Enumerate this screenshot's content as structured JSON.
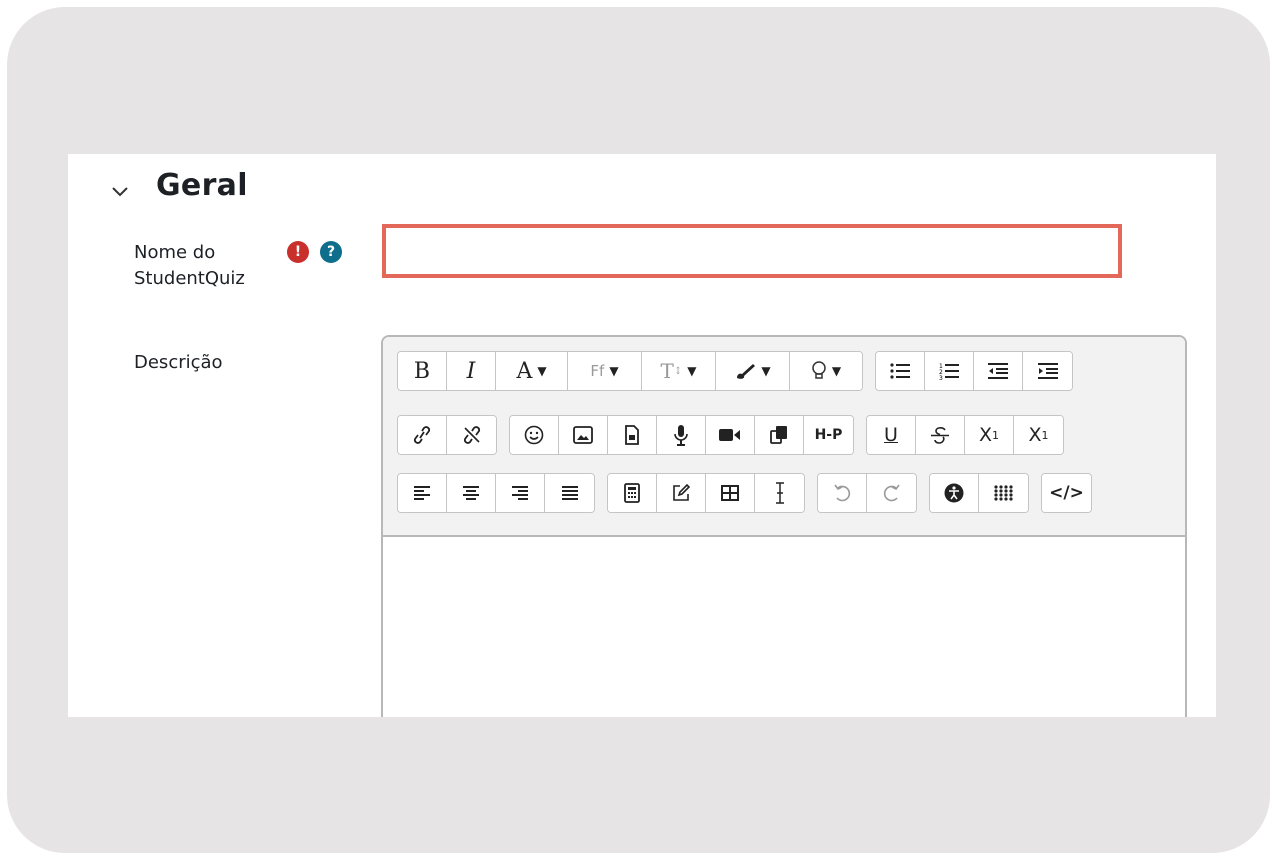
{
  "section": {
    "title": "Geral",
    "toggle_icon": "chevron-down-icon"
  },
  "fields": {
    "name": {
      "label_line1": "Nome do",
      "label_line2": "StudentQuiz",
      "value": "",
      "placeholder": ""
    },
    "description": {
      "label": "Descrição"
    }
  },
  "badges": {
    "required": "!",
    "help": "?"
  },
  "toolbar": {
    "bold": "B",
    "italic": "I",
    "font_color": "A",
    "font_family": "Ff",
    "font_size": "T",
    "subscript_x": "X",
    "subscript_n": "1",
    "superscript_x": "X",
    "superscript_n": "1",
    "h5p": "H-P",
    "html": "</>",
    "underline": "U"
  },
  "colors": {
    "frame": "#e6e4e5",
    "input_border": "#e3685a",
    "required": "#c9302c",
    "help": "#0f6e8c"
  }
}
